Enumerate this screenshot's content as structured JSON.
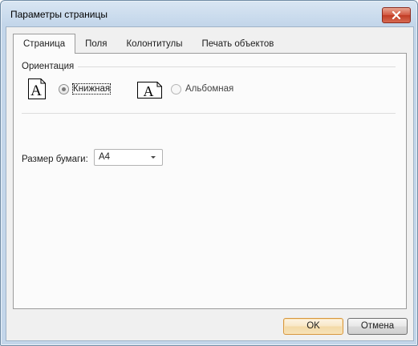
{
  "window": {
    "title": "Параметры страницы"
  },
  "tabs": [
    {
      "label": "Страница",
      "active": true
    },
    {
      "label": "Поля",
      "active": false
    },
    {
      "label": "Колонтитулы",
      "active": false
    },
    {
      "label": "Печать объектов",
      "active": false
    }
  ],
  "orientation": {
    "section_label": "Ориентация",
    "options": [
      {
        "label": "Книжная",
        "selected": true,
        "icon": "portrait-page-icon",
        "icon_glyph": "A"
      },
      {
        "label": "Альбомная",
        "selected": false,
        "icon": "landscape-page-icon",
        "icon_glyph": "A"
      }
    ]
  },
  "paper_size": {
    "label": "Размер бумаги:",
    "value": "A4"
  },
  "buttons": {
    "ok": "OK",
    "cancel": "Отмена"
  },
  "colors": {
    "default_button_border": "#d6963e",
    "close_button": "#c13b23"
  }
}
